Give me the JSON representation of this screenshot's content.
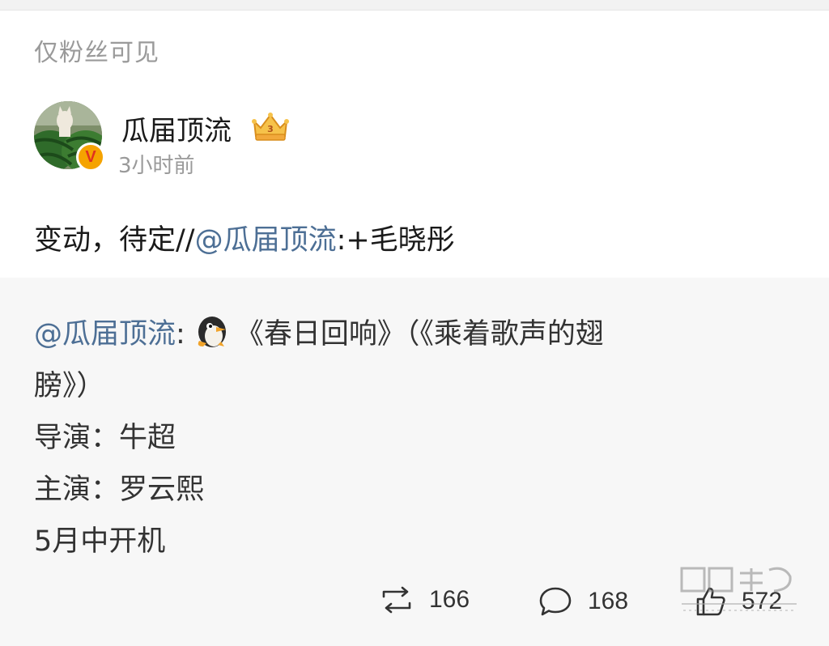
{
  "post": {
    "visibility": "仅粉丝可见",
    "author": {
      "name": "瓜届顶流",
      "time": "3小时前",
      "verified_badge": "V",
      "avatar_icon": "watermelon-avatar-icon",
      "vip_icon": "crown-badge-icon"
    },
    "text": {
      "prefix": "变动，待定//",
      "mention": "@瓜届顶流",
      "suffix": ":+毛晓彤"
    }
  },
  "repost": {
    "mention": "@瓜届顶流",
    "colon": ":",
    "title_line": "《春日回响》（《乘着歌声的翅",
    "title_line_cont": "膀》）",
    "director": "导演：牛超",
    "lead": "主演：罗云熙",
    "schedule": "5月中开机"
  },
  "actions": {
    "repost_count": "166",
    "comment_count": "168",
    "like_count": "572"
  },
  "colors": {
    "mention_blue": "#4d6f95",
    "repost_bg": "#f7f7f7",
    "muted_gray": "#9a9a9a"
  }
}
